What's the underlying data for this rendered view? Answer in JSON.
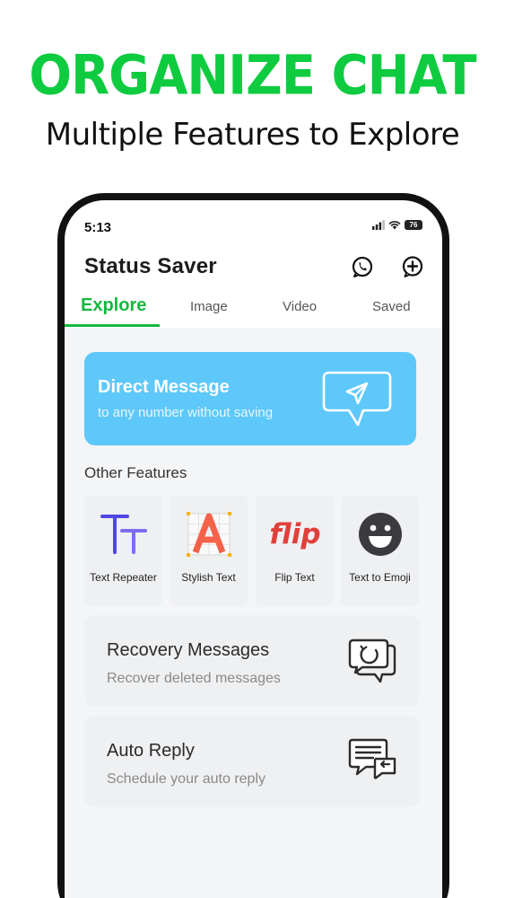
{
  "promo": {
    "headline": "ORGANIZE CHAT",
    "subheadline": "Multiple Features to Explore",
    "accent_color": "#0ecb3f"
  },
  "status_bar": {
    "time": "5:13",
    "battery": "76"
  },
  "app": {
    "title": "Status Saver",
    "header_icons": [
      "whatsapp-icon",
      "add-circle-icon"
    ]
  },
  "tabs": [
    {
      "label": "Explore",
      "active": true
    },
    {
      "label": "Image",
      "active": false
    },
    {
      "label": "Video",
      "active": false
    },
    {
      "label": "Saved",
      "active": false
    }
  ],
  "direct_message": {
    "title": "Direct Message",
    "subtitle": "to any number without saving",
    "icon": "send-message-icon",
    "color": "#5ec8fa"
  },
  "other_features": {
    "label": "Other Features",
    "items": [
      {
        "label": "Text Repeater",
        "icon": "text-repeater-icon"
      },
      {
        "label": "Stylish Text",
        "icon": "stylish-text-icon"
      },
      {
        "label": "Flip Text",
        "icon": "flip-text-icon",
        "icon_text": "flip"
      },
      {
        "label": "Text to Emoji",
        "icon": "emoji-icon"
      }
    ]
  },
  "recovery": {
    "title": "Recovery Messages",
    "subtitle": "Recover deleted messages",
    "icon": "recovery-chat-icon"
  },
  "auto_reply": {
    "title": "Auto Reply",
    "subtitle": "Schedule your auto reply",
    "icon": "auto-reply-icon"
  }
}
